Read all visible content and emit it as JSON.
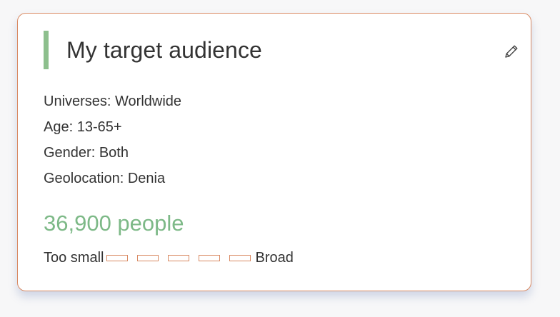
{
  "card": {
    "title": "My target audience",
    "edit_icon": "pencil-icon",
    "details": [
      "Universes: Worldwide",
      "Age: 13-65+",
      "Gender: Both",
      "Geolocation: Denia"
    ],
    "audience_size": "36,900 people",
    "scale": {
      "min_label": "Too small",
      "max_label": "Broad",
      "segments": 5,
      "filled_segments": 0
    }
  },
  "colors": {
    "accent_green": "#7db987",
    "border_orange": "#d98a63",
    "text": "#333333"
  }
}
